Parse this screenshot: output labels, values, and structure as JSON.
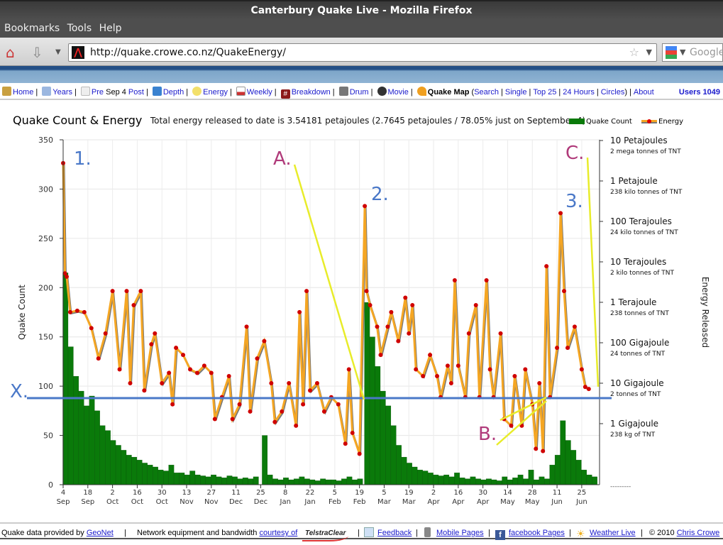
{
  "browser": {
    "window_title": "Canterbury Quake Live - Mozilla Firefox",
    "menu": [
      "Bookmarks",
      "Tools",
      "Help"
    ],
    "url": "http://quake.crowe.co.nz/QuakeEnergy/",
    "search_placeholder": "Google"
  },
  "sitenav": {
    "items": [
      {
        "label": "Home",
        "icon": "home-icon"
      },
      {
        "label": "Years",
        "icon": "calendar-icon"
      },
      {
        "label": "Pre",
        "icon": "page-icon"
      },
      {
        "label": "Depth",
        "icon": "arrow-down-icon"
      },
      {
        "label": "Energy",
        "icon": "lightbulb-icon"
      },
      {
        "label": "Weekly",
        "icon": "weekly-icon"
      },
      {
        "label": "Breakdown",
        "icon": "hash-icon"
      },
      {
        "label": "Drum",
        "icon": "drum-icon"
      },
      {
        "label": "Movie",
        "icon": "film-reel-icon"
      }
    ],
    "pre_middle": "Sep 4",
    "post_label": "Post",
    "quake_map": "Quake Map",
    "map_sub": [
      "Search",
      "Single",
      "Top 25",
      "24 Hours",
      "Circles"
    ],
    "about": "About",
    "users": "Users 1049"
  },
  "chart_header": {
    "title": "Quake Count & Energy",
    "description": "Total energy released to date is 3.54181 petajoules (2.7645 petajoules / 78.05% just on September 4)"
  },
  "chart_data": {
    "type": "bar+line",
    "legend": [
      {
        "name": "Quake Count",
        "color": "#0a7a0a"
      },
      {
        "name": "Energy",
        "color": "#f5a623",
        "marker": "#d00000"
      }
    ],
    "legend_placement": "top-right",
    "ylabel_left": "Quake Count",
    "ylabel_right": "Energy Released",
    "y_left_range": [
      0,
      350
    ],
    "y_left_ticks": [
      "0",
      "50",
      "100",
      "150",
      "200",
      "250",
      "300",
      "350"
    ],
    "y_right_scale": "log",
    "y_right_unit": "gigajoules",
    "y_right_ticks": [
      {
        "gj": 10000000,
        "label": "10 Petajoules",
        "sub": "2 mega tonnes of TNT"
      },
      {
        "gj": 1000000,
        "label": "1 Petajoule",
        "sub": "238 kilo tonnes of TNT"
      },
      {
        "gj": 100000,
        "label": "100 Terajoules",
        "sub": "24 kilo tonnes of TNT"
      },
      {
        "gj": 10000,
        "label": "10 Terajoules",
        "sub": "2 kilo tonnes of TNT"
      },
      {
        "gj": 1000,
        "label": "1 Terajoule",
        "sub": "238 tonnes of TNT"
      },
      {
        "gj": 100,
        "label": "100 Gigajoule",
        "sub": "24 tonnes of TNT"
      },
      {
        "gj": 10,
        "label": "10 Gigajoule",
        "sub": "2 tonnes of TNT"
      },
      {
        "gj": 1,
        "label": "1 Gigajoule",
        "sub": "238 kg of TNT"
      }
    ],
    "y_right_bottom_mark": "---------",
    "x_range": [
      "2010-09-04",
      "2011-07-04"
    ],
    "x_ticks": [
      {
        "date": "2010-09-04",
        "d": "4",
        "m": "Sep"
      },
      {
        "date": "2010-09-18",
        "d": "18",
        "m": "Sep"
      },
      {
        "date": "2010-10-02",
        "d": "2",
        "m": "Oct"
      },
      {
        "date": "2010-10-16",
        "d": "16",
        "m": "Oct"
      },
      {
        "date": "2010-10-30",
        "d": "30",
        "m": "Oct"
      },
      {
        "date": "2010-11-13",
        "d": "13",
        "m": "Nov"
      },
      {
        "date": "2010-11-27",
        "d": "27",
        "m": "Nov"
      },
      {
        "date": "2010-12-11",
        "d": "11",
        "m": "Dec"
      },
      {
        "date": "2010-12-25",
        "d": "25",
        "m": "Dec"
      },
      {
        "date": "2011-01-08",
        "d": "8",
        "m": "Jan"
      },
      {
        "date": "2011-01-22",
        "d": "22",
        "m": "Jan"
      },
      {
        "date": "2011-02-05",
        "d": "5",
        "m": "Feb"
      },
      {
        "date": "2011-02-19",
        "d": "19",
        "m": "Feb"
      },
      {
        "date": "2011-03-05",
        "d": "5",
        "m": "Mar"
      },
      {
        "date": "2011-03-19",
        "d": "19",
        "m": "Mar"
      },
      {
        "date": "2011-04-02",
        "d": "2",
        "m": "Apr"
      },
      {
        "date": "2011-04-16",
        "d": "16",
        "m": "Apr"
      },
      {
        "date": "2011-04-30",
        "d": "30",
        "m": "Apr"
      },
      {
        "date": "2011-05-14",
        "d": "14",
        "m": "May"
      },
      {
        "date": "2011-05-28",
        "d": "28",
        "m": "May"
      },
      {
        "date": "2011-06-11",
        "d": "11",
        "m": "Jun"
      },
      {
        "date": "2011-06-25",
        "d": "25",
        "m": "Jun"
      }
    ],
    "grid": true,
    "count_series": [
      [
        "2010-09-04",
        215
      ],
      [
        "2010-09-07",
        140
      ],
      [
        "2010-09-10",
        110
      ],
      [
        "2010-09-13",
        95
      ],
      [
        "2010-09-16",
        80
      ],
      [
        "2010-09-19",
        90
      ],
      [
        "2010-09-22",
        75
      ],
      [
        "2010-09-25",
        60
      ],
      [
        "2010-09-28",
        55
      ],
      [
        "2010-10-01",
        45
      ],
      [
        "2010-10-04",
        40
      ],
      [
        "2010-10-07",
        35
      ],
      [
        "2010-10-10",
        30
      ],
      [
        "2010-10-13",
        28
      ],
      [
        "2010-10-16",
        25
      ],
      [
        "2010-10-19",
        22
      ],
      [
        "2010-10-22",
        20
      ],
      [
        "2010-10-25",
        18
      ],
      [
        "2010-10-28",
        15
      ],
      [
        "2010-10-31",
        14
      ],
      [
        "2010-11-03",
        20
      ],
      [
        "2010-11-06",
        12
      ],
      [
        "2010-11-09",
        12
      ],
      [
        "2010-11-12",
        10
      ],
      [
        "2010-11-15",
        14
      ],
      [
        "2010-11-18",
        10
      ],
      [
        "2010-11-21",
        9
      ],
      [
        "2010-11-24",
        8
      ],
      [
        "2010-11-27",
        10
      ],
      [
        "2010-11-30",
        8
      ],
      [
        "2010-12-03",
        7
      ],
      [
        "2010-12-06",
        9
      ],
      [
        "2010-12-09",
        8
      ],
      [
        "2010-12-12",
        6
      ],
      [
        "2010-12-15",
        7
      ],
      [
        "2010-12-18",
        6
      ],
      [
        "2010-12-21",
        8
      ],
      [
        "2010-12-26",
        50
      ],
      [
        "2010-12-29",
        10
      ],
      [
        "2011-01-01",
        6
      ],
      [
        "2011-01-04",
        5
      ],
      [
        "2011-01-07",
        7
      ],
      [
        "2011-01-10",
        5
      ],
      [
        "2011-01-13",
        6
      ],
      [
        "2011-01-16",
        8
      ],
      [
        "2011-01-19",
        6
      ],
      [
        "2011-01-22",
        5
      ],
      [
        "2011-01-25",
        4
      ],
      [
        "2011-01-28",
        6
      ],
      [
        "2011-01-31",
        5
      ],
      [
        "2011-02-03",
        5
      ],
      [
        "2011-02-06",
        4
      ],
      [
        "2011-02-09",
        6
      ],
      [
        "2011-02-12",
        8
      ],
      [
        "2011-02-15",
        5
      ],
      [
        "2011-02-18",
        6
      ],
      [
        "2011-02-22",
        185
      ],
      [
        "2011-02-25",
        150
      ],
      [
        "2011-02-28",
        120
      ],
      [
        "2011-03-03",
        95
      ],
      [
        "2011-03-06",
        80
      ],
      [
        "2011-03-09",
        60
      ],
      [
        "2011-03-12",
        40
      ],
      [
        "2011-03-15",
        28
      ],
      [
        "2011-03-18",
        22
      ],
      [
        "2011-03-21",
        18
      ],
      [
        "2011-03-24",
        15
      ],
      [
        "2011-03-27",
        14
      ],
      [
        "2011-03-30",
        12
      ],
      [
        "2011-04-02",
        10
      ],
      [
        "2011-04-05",
        9
      ],
      [
        "2011-04-08",
        10
      ],
      [
        "2011-04-11",
        8
      ],
      [
        "2011-04-14",
        12
      ],
      [
        "2011-04-17",
        7
      ],
      [
        "2011-04-20",
        6
      ],
      [
        "2011-04-23",
        8
      ],
      [
        "2011-04-26",
        6
      ],
      [
        "2011-04-29",
        5
      ],
      [
        "2011-05-02",
        6
      ],
      [
        "2011-05-05",
        5
      ],
      [
        "2011-05-08",
        4
      ],
      [
        "2011-05-11",
        8
      ],
      [
        "2011-05-14",
        5
      ],
      [
        "2011-05-17",
        7
      ],
      [
        "2011-05-20",
        10
      ],
      [
        "2011-05-23",
        6
      ],
      [
        "2011-05-26",
        15
      ],
      [
        "2011-05-29",
        5
      ],
      [
        "2011-06-01",
        8
      ],
      [
        "2011-06-04",
        6
      ],
      [
        "2011-06-07",
        20
      ],
      [
        "2011-06-10",
        30
      ],
      [
        "2011-06-13",
        65
      ],
      [
        "2011-06-16",
        45
      ],
      [
        "2011-06-19",
        35
      ],
      [
        "2011-06-22",
        25
      ],
      [
        "2011-06-25",
        15
      ],
      [
        "2011-06-28",
        10
      ],
      [
        "2011-07-01",
        8
      ]
    ],
    "energy_series_gj": [
      [
        "2010-09-04",
        2764500
      ],
      [
        "2010-09-05",
        5200
      ],
      [
        "2010-09-06",
        4300
      ],
      [
        "2010-09-08",
        570
      ],
      [
        "2010-09-12",
        620
      ],
      [
        "2010-09-16",
        570
      ],
      [
        "2010-09-20",
        230
      ],
      [
        "2010-09-24",
        41
      ],
      [
        "2010-09-28",
        170
      ],
      [
        "2010-10-02",
        1900
      ],
      [
        "2010-10-06",
        22
      ],
      [
        "2010-10-10",
        1900
      ],
      [
        "2010-10-12",
        10
      ],
      [
        "2010-10-14",
        850
      ],
      [
        "2010-10-18",
        1900
      ],
      [
        "2010-10-20",
        6.6
      ],
      [
        "2010-10-24",
        92
      ],
      [
        "2010-10-26",
        170
      ],
      [
        "2010-10-30",
        10
      ],
      [
        "2010-11-03",
        18
      ],
      [
        "2010-11-05",
        3.0
      ],
      [
        "2010-11-07",
        75
      ],
      [
        "2010-11-11",
        50
      ],
      [
        "2010-11-15",
        22
      ],
      [
        "2010-11-19",
        18
      ],
      [
        "2010-11-23",
        27
      ],
      [
        "2010-11-27",
        18
      ],
      [
        "2010-11-29",
        1.3
      ],
      [
        "2010-12-03",
        4.5
      ],
      [
        "2010-12-07",
        15
      ],
      [
        "2010-12-09",
        1.3
      ],
      [
        "2010-12-13",
        3.0
      ],
      [
        "2010-12-17",
        250
      ],
      [
        "2010-12-19",
        2.0
      ],
      [
        "2010-12-23",
        41
      ],
      [
        "2010-12-27",
        110
      ],
      [
        "2010-12-31",
        10
      ],
      [
        "2011-01-02",
        1.1
      ],
      [
        "2011-01-06",
        2.0
      ],
      [
        "2011-01-10",
        10
      ],
      [
        "2011-01-14",
        0.89
      ],
      [
        "2011-01-16",
        570
      ],
      [
        "2011-01-18",
        3.0
      ],
      [
        "2011-01-20",
        1900
      ],
      [
        "2011-01-22",
        6.6
      ],
      [
        "2011-01-26",
        10
      ],
      [
        "2011-01-30",
        2.0
      ],
      [
        "2011-02-03",
        4.5
      ],
      [
        "2011-02-07",
        3.0
      ],
      [
        "2011-02-11",
        0.32
      ],
      [
        "2011-02-13",
        22
      ],
      [
        "2011-02-15",
        0.59
      ],
      [
        "2011-02-19",
        0.18
      ],
      [
        "2011-02-22",
        240000
      ],
      [
        "2011-02-23",
        1900
      ],
      [
        "2011-02-25",
        850
      ],
      [
        "2011-03-01",
        250
      ],
      [
        "2011-03-03",
        50
      ],
      [
        "2011-03-07",
        250
      ],
      [
        "2011-03-09",
        570
      ],
      [
        "2011-03-13",
        110
      ],
      [
        "2011-03-17",
        1300
      ],
      [
        "2011-03-19",
        170
      ],
      [
        "2011-03-21",
        850
      ],
      [
        "2011-03-23",
        22
      ],
      [
        "2011-03-27",
        15
      ],
      [
        "2011-03-31",
        50
      ],
      [
        "2011-04-04",
        15
      ],
      [
        "2011-04-06",
        4.5
      ],
      [
        "2011-04-10",
        27
      ],
      [
        "2011-04-12",
        10
      ],
      [
        "2011-04-14",
        3500
      ],
      [
        "2011-04-16",
        27
      ],
      [
        "2011-04-20",
        4.5
      ],
      [
        "2011-04-22",
        170
      ],
      [
        "2011-04-26",
        850
      ],
      [
        "2011-04-28",
        4.5
      ],
      [
        "2011-05-02",
        3500
      ],
      [
        "2011-05-04",
        22
      ],
      [
        "2011-05-06",
        4.5
      ],
      [
        "2011-05-10",
        170
      ],
      [
        "2011-05-12",
        1.3
      ],
      [
        "2011-05-16",
        0.89
      ],
      [
        "2011-05-18",
        15
      ],
      [
        "2011-05-22",
        0.89
      ],
      [
        "2011-05-24",
        22
      ],
      [
        "2011-05-28",
        3.0
      ],
      [
        "2011-05-30",
        0.24
      ],
      [
        "2011-06-01",
        10
      ],
      [
        "2011-06-03",
        0.21
      ],
      [
        "2011-06-05",
        7800
      ],
      [
        "2011-06-07",
        4.5
      ],
      [
        "2011-06-11",
        75
      ],
      [
        "2011-06-13",
        160000
      ],
      [
        "2011-06-15",
        1900
      ],
      [
        "2011-06-17",
        75
      ],
      [
        "2011-06-21",
        250
      ],
      [
        "2011-06-25",
        22
      ],
      [
        "2011-06-27",
        8.1
      ],
      [
        "2011-06-29",
        7.2
      ]
    ]
  },
  "annotations": {
    "labels": [
      {
        "text": "1.",
        "color": "#4a78c8"
      },
      {
        "text": "2.",
        "color": "#4a78c8"
      },
      {
        "text": "3.",
        "color": "#4a78c8"
      },
      {
        "text": "A.",
        "color": "#b03a7a"
      },
      {
        "text": "B.",
        "color": "#b03a7a"
      },
      {
        "text": "C.",
        "color": "#b03a7a"
      },
      {
        "text": "X.",
        "color": "#4a78c8"
      }
    ],
    "pointer_color": "#e8ec2a",
    "reference_line_color": "#4a78c8"
  },
  "footer": {
    "provided_by": "Quake data provided by",
    "geonet": "GeoNet",
    "network": "Network equipment and bandwidth",
    "courtesy": "courtesy of",
    "sponsor": "TelstraClear",
    "feedback": "Feedback",
    "mobile": "Mobile Pages",
    "facebook": "facebook Pages",
    "weather": "Weather Live",
    "copyright": "© 2010",
    "author": "Chris Crowe"
  }
}
